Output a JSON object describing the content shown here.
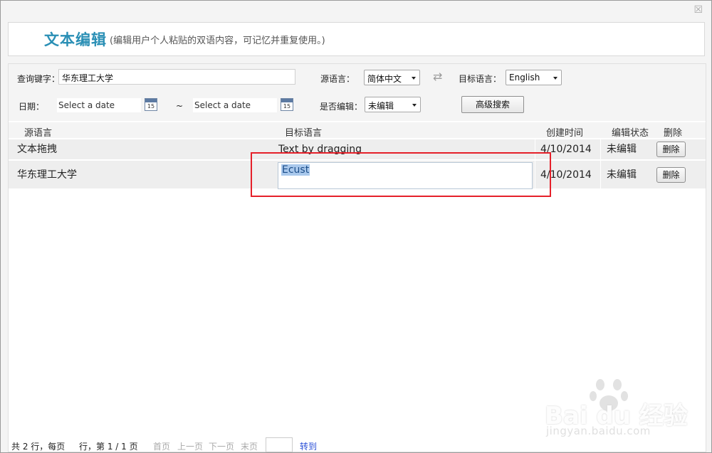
{
  "window": {
    "close_label": "☒"
  },
  "header": {
    "title": "文本编辑",
    "subtitle": "(编辑用户个人粘贴的双语内容，可记忆并重复使用。)"
  },
  "search": {
    "keyword_label": "查询键字：",
    "keyword_value": "华东理工大学",
    "source_lang_label": "源语言：",
    "source_lang_value": "简体中文",
    "target_lang_label": "目标语言：",
    "target_lang_value": "English",
    "date_label": "日期：",
    "date_from_placeholder": "Select a date",
    "date_to_placeholder": "Select a date",
    "date_sep": "~",
    "calendar_day": "15",
    "edited_label": "是否编辑：",
    "edited_value": "未编辑",
    "advanced_button": "高级搜索"
  },
  "table": {
    "headers": [
      "源语言",
      "目标语言",
      "创建时间",
      "编辑状态",
      "删除"
    ],
    "rows": [
      {
        "source": "文本拖拽",
        "target": "Text by dragging",
        "created": "4/10/2014",
        "status": "未编辑",
        "delete": "删除"
      },
      {
        "source": "华东理工大学",
        "target": "Ecust",
        "created": "4/10/2014",
        "status": "未编辑",
        "delete": "删除"
      }
    ]
  },
  "footer": {
    "summary": "共 2 行，每页",
    "page_info": "行，第 1 / 1 页",
    "first": "首页",
    "prev": "上一页",
    "next": "下一页",
    "last": "末页",
    "goto": "转到"
  },
  "watermark": {
    "brand": "Bai du 经验",
    "url": "jingyan.baidu.com"
  },
  "colors": {
    "accent": "#2a8fb5",
    "highlight_box": "#e5202a"
  }
}
